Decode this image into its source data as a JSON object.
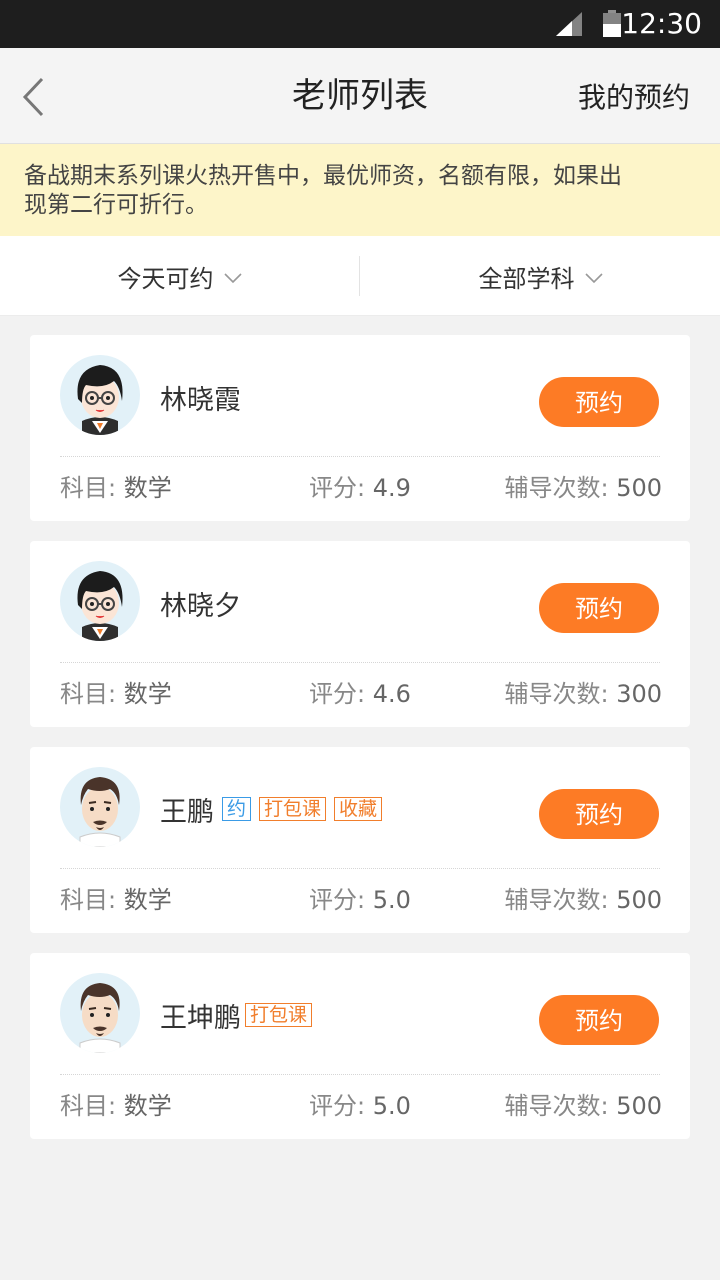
{
  "status_bar": {
    "time": "12:30"
  },
  "nav": {
    "title": "老师列表",
    "right_link": "我的预约"
  },
  "notice": {
    "text": "备战期末系列课火热开售中，最优师资，名额有限，如果出现第二行可折行。"
  },
  "filters": [
    {
      "label": "今天可约"
    },
    {
      "label": "全部学科"
    }
  ],
  "labels": {
    "subject": "科目: ",
    "score": "评分: ",
    "count": "辅导次数: "
  },
  "teachers": [
    {
      "name": "林晓霞",
      "tags": [],
      "book_label": "预约",
      "subject": "数学",
      "score": "4.9",
      "count": "500",
      "avatar": "female-teacher-avatar"
    },
    {
      "name": "林晓夕",
      "tags": [],
      "book_label": "预约",
      "subject": "数学",
      "score": "4.6",
      "count": "300",
      "avatar": "female-teacher-avatar"
    },
    {
      "name": "王鹏",
      "tags": [
        {
          "text": "约",
          "color": "#3a9be6"
        },
        {
          "text": "打包课",
          "color": "#f17e2c"
        },
        {
          "text": "收藏",
          "color": "#f17e2c"
        }
      ],
      "book_label": "预约",
      "subject": "数学",
      "score": "5.0",
      "count": "500",
      "avatar": "male-teacher-avatar"
    },
    {
      "name": "王坤鹏",
      "tags": [
        {
          "text": "打包课",
          "color": "#f17e2c"
        }
      ],
      "book_label": "预约",
      "subject": "数学",
      "score": "5.0",
      "count": "500",
      "avatar": "male-teacher-avatar"
    }
  ],
  "colors": {
    "accent": "#fd7b25",
    "notice_bg": "#fdf5c9",
    "tag_blue": "#3a9be6",
    "tag_orange": "#f17e2c"
  }
}
